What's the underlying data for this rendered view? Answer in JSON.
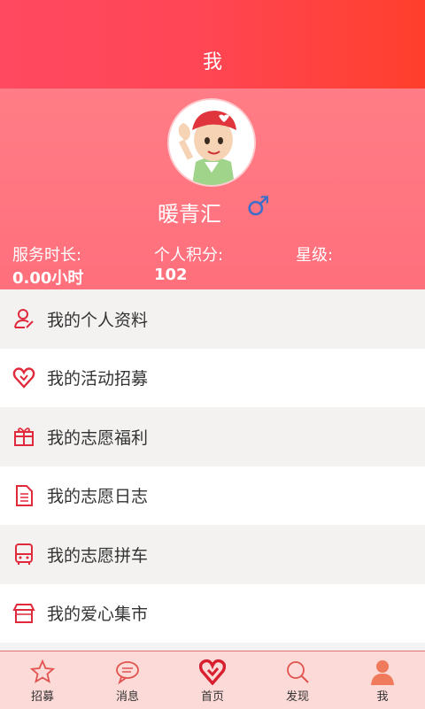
{
  "header": {
    "title": "我"
  },
  "profile": {
    "username": "暖青汇",
    "gender_symbol": "♂",
    "stats": [
      {
        "label": "服务时长:",
        "value": "0.00小时"
      },
      {
        "label": "个人积分:",
        "value": "102"
      },
      {
        "label": "星级:",
        "value": ""
      }
    ]
  },
  "menu": [
    {
      "label": "我的个人资料",
      "icon": "user-edit-icon"
    },
    {
      "label": "我的活动招募",
      "icon": "heart-icon"
    },
    {
      "label": "我的志愿福利",
      "icon": "gift-icon"
    },
    {
      "label": "我的志愿日志",
      "icon": "document-icon"
    },
    {
      "label": "我的志愿拼车",
      "icon": "bus-icon"
    },
    {
      "label": "我的爱心集市",
      "icon": "shop-icon"
    }
  ],
  "tabbar": [
    {
      "label": "招募",
      "icon": "star-icon"
    },
    {
      "label": "消息",
      "icon": "chat-icon"
    },
    {
      "label": "首页",
      "icon": "heart-home-icon"
    },
    {
      "label": "发现",
      "icon": "search-icon"
    },
    {
      "label": "我",
      "icon": "person-icon"
    }
  ],
  "colors": {
    "accent": "#e02a3c",
    "header": "#ff4656",
    "profile_bg": "#ff7d86",
    "tabbar_bg": "#fbdad7"
  }
}
